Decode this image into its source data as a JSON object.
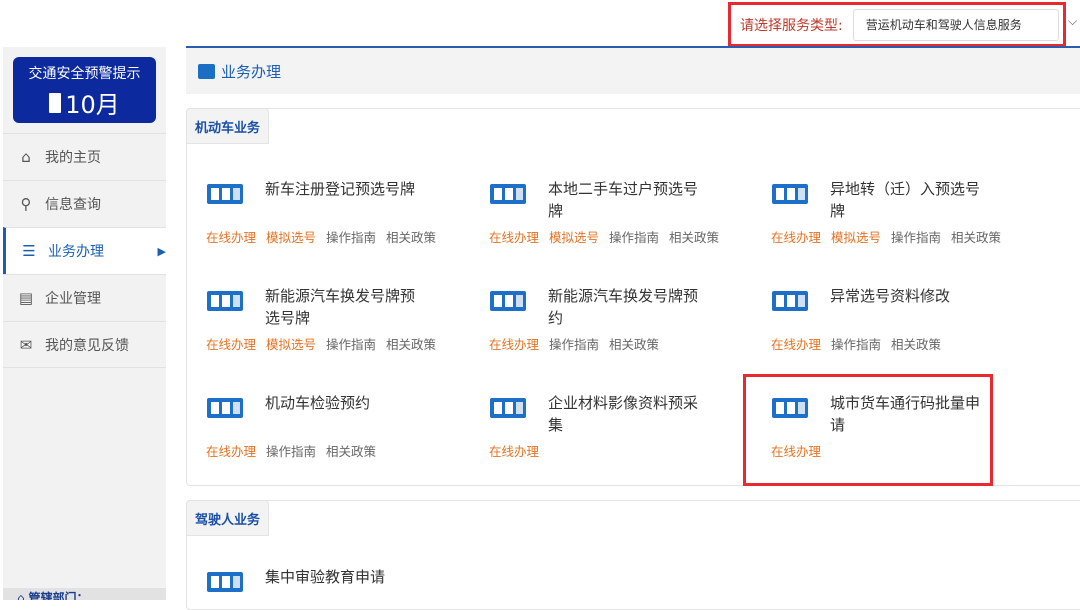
{
  "service_select": {
    "label": "请选择服务类型:",
    "value": "营运机动车和驾驶人信息服务"
  },
  "sidebar": {
    "warning_title": "交通安全预警提示",
    "warning_month": "10月",
    "items": [
      {
        "label": "我的主页",
        "icon": "home-icon"
      },
      {
        "label": "信息查询",
        "icon": "search-icon"
      },
      {
        "label": "业务办理",
        "icon": "inbox-icon"
      },
      {
        "label": "企业管理",
        "icon": "document-icon"
      },
      {
        "label": "我的意见反馈",
        "icon": "feedback-icon"
      }
    ],
    "footer": "管辖部门："
  },
  "header": {
    "title": "业务办理"
  },
  "sections": [
    {
      "title": "机动车业务",
      "items": [
        {
          "name": "新车注册登记预选号牌",
          "icon": "plate-icon",
          "links": [
            "在线办理",
            "模拟选号",
            "操作指南",
            "相关政策"
          ]
        },
        {
          "name": "本地二手车过户预选号牌",
          "icon": "plate-icon",
          "links": [
            "在线办理",
            "模拟选号",
            "操作指南",
            "相关政策"
          ]
        },
        {
          "name": "异地转（迁）入预选号牌",
          "icon": "plate-icon",
          "links": [
            "在线办理",
            "模拟选号",
            "操作指南",
            "相关政策"
          ]
        },
        {
          "name": "新能源汽车换发号牌预选号牌",
          "icon": "plate-refresh-icon",
          "links": [
            "在线办理",
            "模拟选号",
            "操作指南",
            "相关政策"
          ]
        },
        {
          "name": "新能源汽车换发号牌预约",
          "icon": "plate-clock-icon",
          "links": [
            "在线办理",
            "操作指南",
            "相关政策"
          ]
        },
        {
          "name": "异常选号资料修改",
          "icon": "handshake-icon",
          "links": [
            "在线办理",
            "操作指南",
            "相关政策"
          ]
        },
        {
          "name": "机动车检验预约",
          "icon": "truck-search-icon",
          "links": [
            "在线办理",
            "操作指南",
            "相关政策"
          ]
        },
        {
          "name": "企业材料影像资料预采集",
          "icon": "document-icon",
          "links": [
            "在线办理"
          ]
        },
        {
          "name": "城市货车通行码批量申请",
          "icon": "car-card-icon",
          "links": [
            "在线办理"
          ]
        }
      ]
    },
    {
      "title": "驾驶人业务",
      "items": [
        {
          "name": "集中审验教育申请",
          "icon": "id-card-check-icon",
          "links": []
        }
      ]
    }
  ],
  "colors": {
    "accent": "#1a5fb4",
    "link_orange": "#e67323",
    "highlight": "#e8292f",
    "warning_bg": "#0c2a9e"
  }
}
